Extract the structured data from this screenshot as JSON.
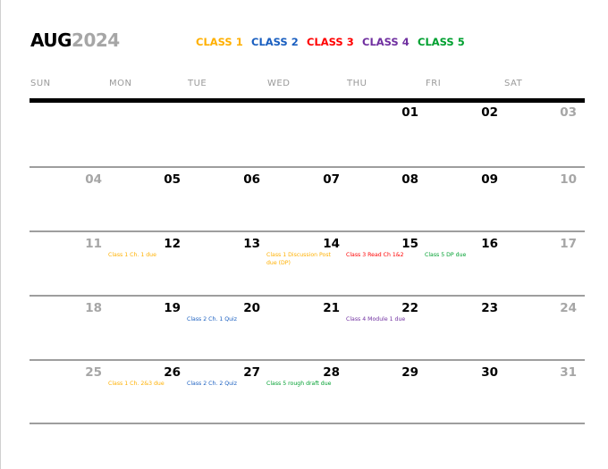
{
  "header": {
    "month": "AUG",
    "year": "2024"
  },
  "legend": [
    {
      "label": "CLASS 1",
      "color": "#ffb000"
    },
    {
      "label": "CLASS 2",
      "color": "#1a5fc0"
    },
    {
      "label": "CLASS 3",
      "color": "#ff0000"
    },
    {
      "label": "CLASS 4",
      "color": "#7030a0"
    },
    {
      "label": "CLASS 5",
      "color": "#00a030"
    }
  ],
  "weekdays": [
    "SUN",
    "MON",
    "TUE",
    "WED",
    "THU",
    "FRI",
    "SAT"
  ],
  "weeks": [
    [
      {
        "day": "",
        "type": "empty"
      },
      {
        "day": "",
        "type": "empty"
      },
      {
        "day": "",
        "type": "empty"
      },
      {
        "day": "",
        "type": "empty"
      },
      {
        "day": "01",
        "type": "weekday"
      },
      {
        "day": "02",
        "type": "weekday"
      },
      {
        "day": "03",
        "type": "weekend"
      }
    ],
    [
      {
        "day": "04",
        "type": "weekend"
      },
      {
        "day": "05",
        "type": "weekday"
      },
      {
        "day": "06",
        "type": "weekday"
      },
      {
        "day": "07",
        "type": "weekday"
      },
      {
        "day": "08",
        "type": "weekday"
      },
      {
        "day": "09",
        "type": "weekday"
      },
      {
        "day": "10",
        "type": "weekend"
      }
    ],
    [
      {
        "day": "11",
        "type": "weekend"
      },
      {
        "day": "12",
        "type": "weekday"
      },
      {
        "day": "13",
        "type": "weekday"
      },
      {
        "day": "14",
        "type": "weekday"
      },
      {
        "day": "15",
        "type": "weekday"
      },
      {
        "day": "16",
        "type": "weekday"
      },
      {
        "day": "17",
        "type": "weekend"
      }
    ],
    [
      {
        "day": "18",
        "type": "weekend"
      },
      {
        "day": "19",
        "type": "weekday"
      },
      {
        "day": "20",
        "type": "weekday"
      },
      {
        "day": "21",
        "type": "weekday"
      },
      {
        "day": "22",
        "type": "weekday"
      },
      {
        "day": "23",
        "type": "weekday"
      },
      {
        "day": "24",
        "type": "weekend"
      }
    ],
    [
      {
        "day": "25",
        "type": "weekend"
      },
      {
        "day": "26",
        "type": "weekday"
      },
      {
        "day": "27",
        "type": "weekday"
      },
      {
        "day": "28",
        "type": "weekday"
      },
      {
        "day": "29",
        "type": "weekday"
      },
      {
        "day": "30",
        "type": "weekday"
      },
      {
        "day": "31",
        "type": "weekend"
      }
    ]
  ],
  "events": [
    {
      "week": 2,
      "col": 1,
      "text": "Class 1 Ch. 1 due",
      "class": 1
    },
    {
      "week": 2,
      "col": 3,
      "text": "Class 1 Discussion Post due (DP)",
      "class": 1
    },
    {
      "week": 2,
      "col": 4,
      "text": "Class 3 Read Ch 1&2",
      "class": 3
    },
    {
      "week": 2,
      "col": 5,
      "text": "Class 5 DP due",
      "class": 5
    },
    {
      "week": 3,
      "col": 2,
      "text": "Class 2 Ch. 1 Quiz",
      "class": 2
    },
    {
      "week": 3,
      "col": 4,
      "text": "Class 4 Module 1 due",
      "class": 4
    },
    {
      "week": 4,
      "col": 1,
      "text": "Class 1 Ch. 2&3 due",
      "class": 1
    },
    {
      "week": 4,
      "col": 2,
      "text": "Class 2 Ch. 2 Quiz",
      "class": 2
    },
    {
      "week": 4,
      "col": 3,
      "text": "Class 5 rough draft due",
      "class": 5
    }
  ]
}
